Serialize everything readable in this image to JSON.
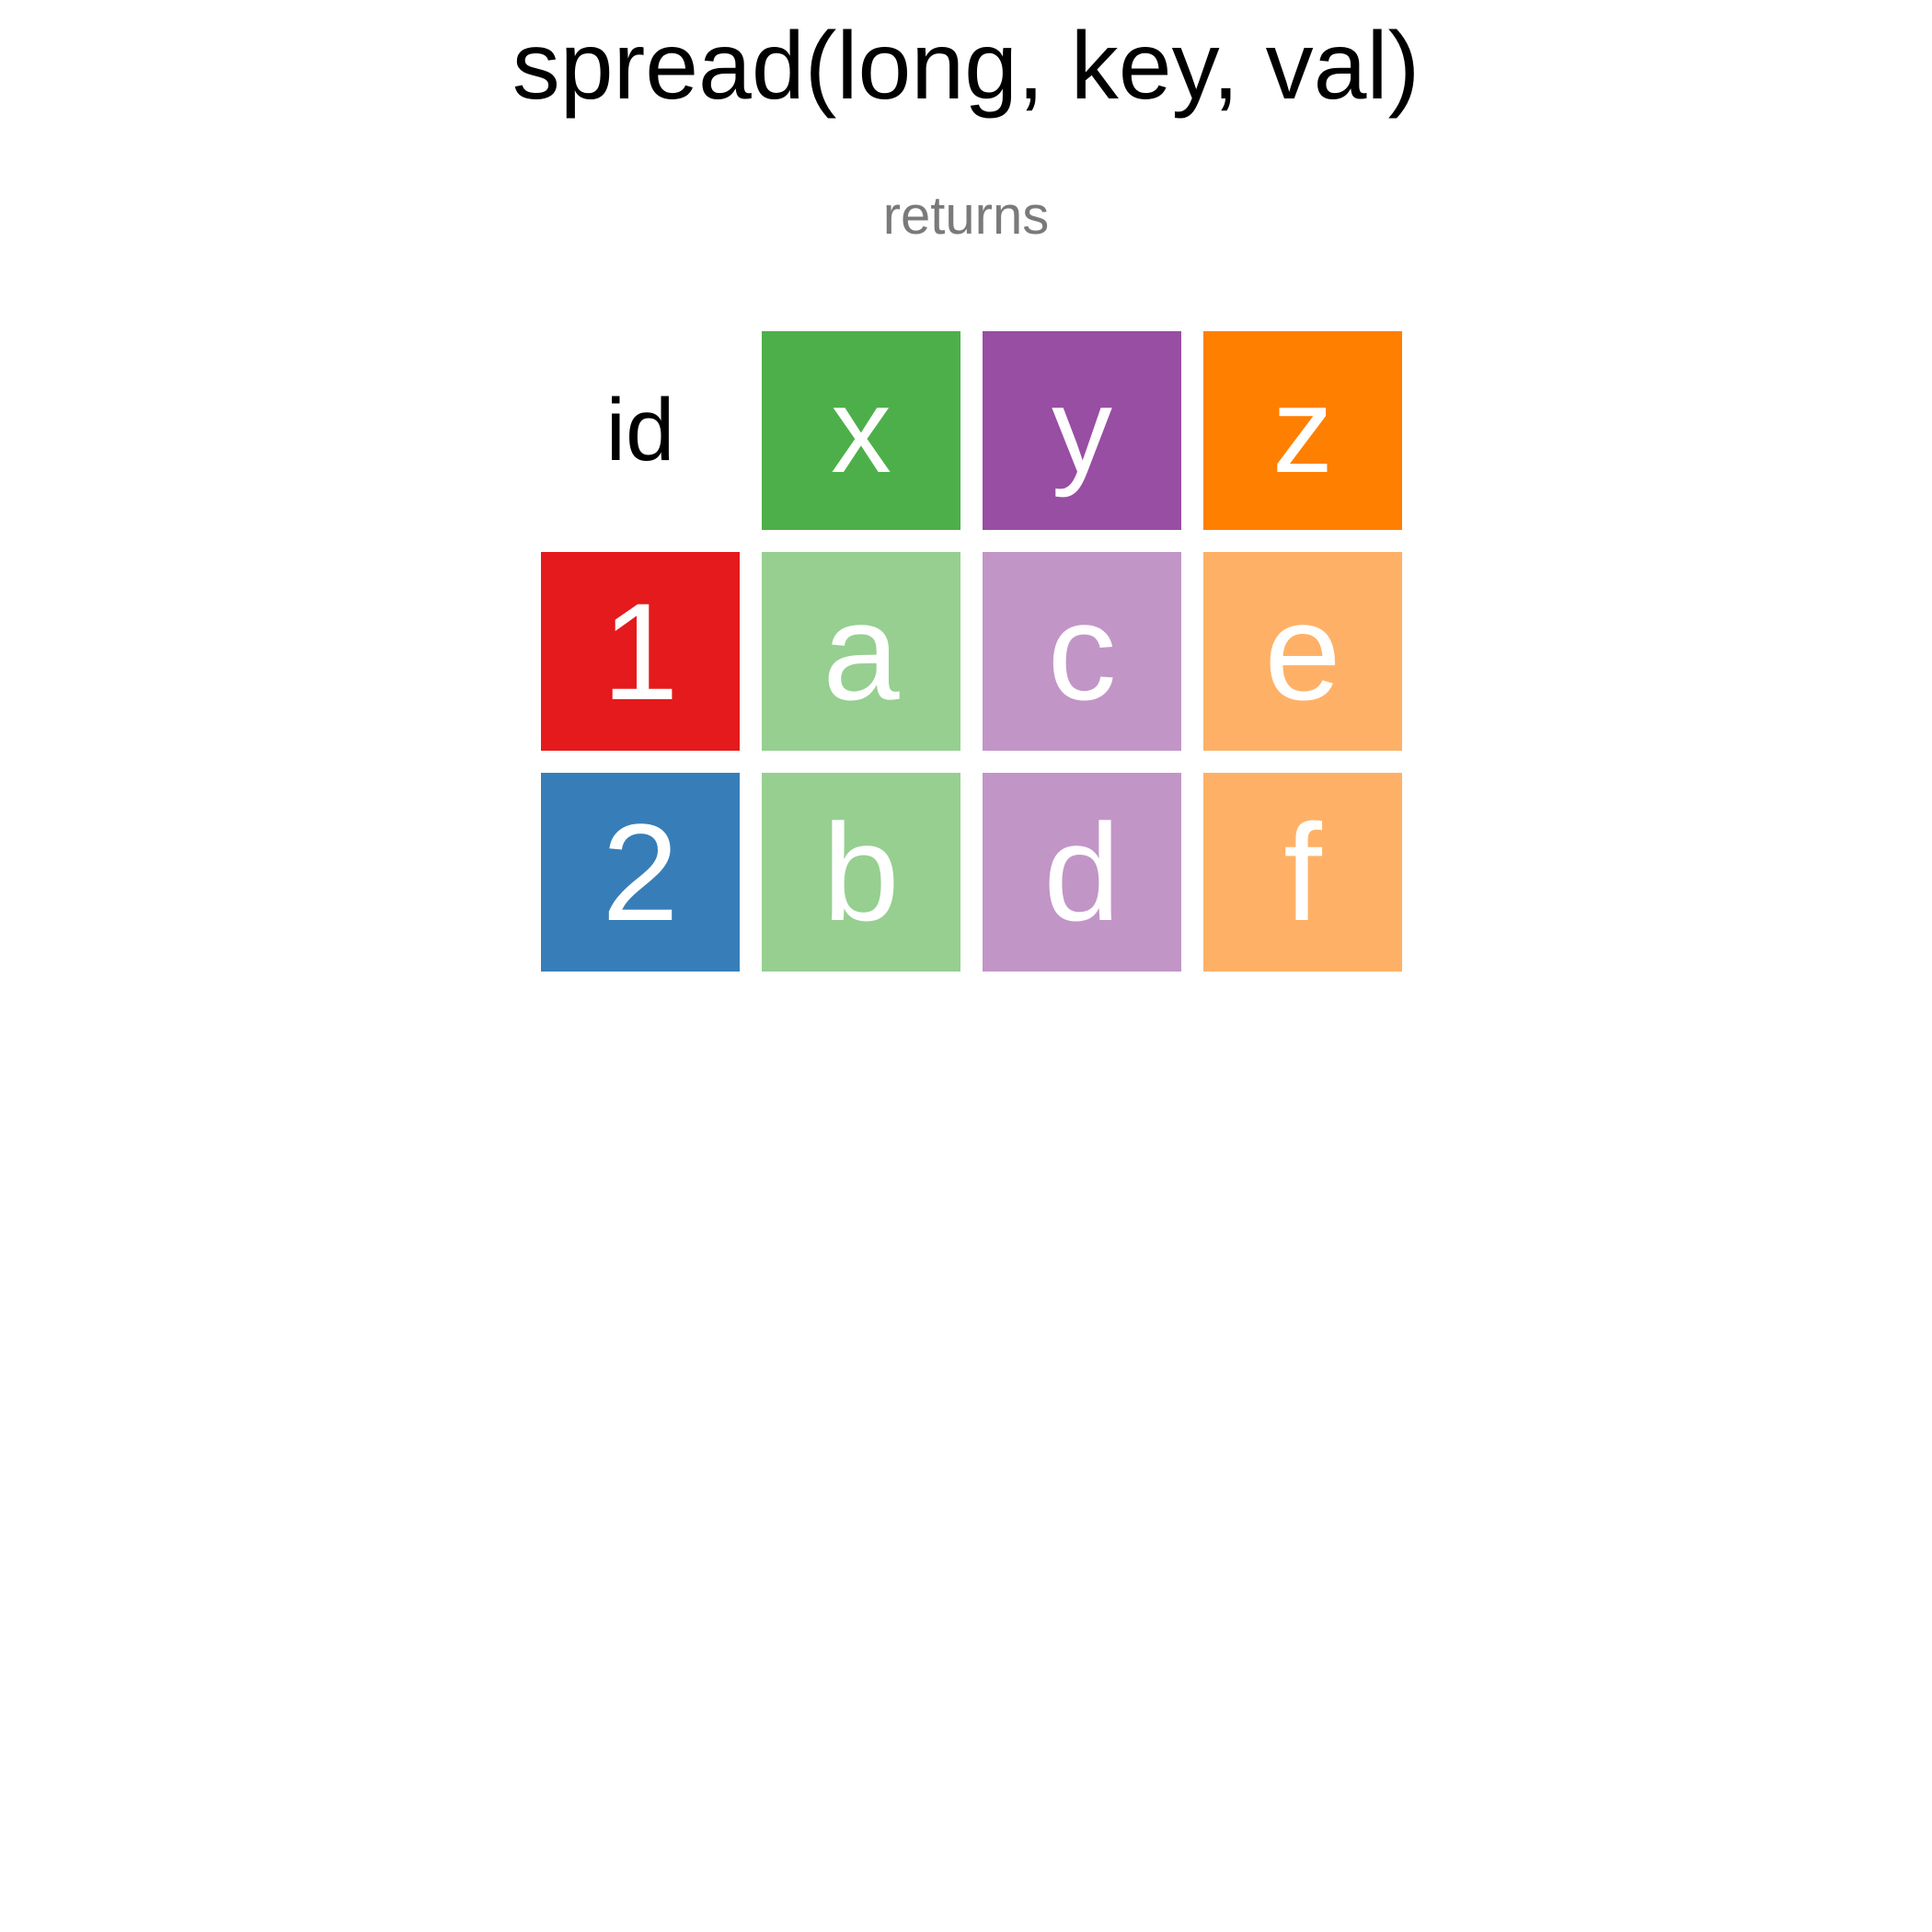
{
  "title": "spread(long, key, val)",
  "subtitle": "returns",
  "table": {
    "header": [
      {
        "label": "id",
        "color": "#ffffff"
      },
      {
        "label": "x",
        "color": "#4daf4a"
      },
      {
        "label": "y",
        "color": "#984ea3"
      },
      {
        "label": "z",
        "color": "#ff7f00"
      }
    ],
    "rows": [
      [
        {
          "label": "1",
          "color": "#e41a1c"
        },
        {
          "label": "a",
          "color": "#96cf90"
        },
        {
          "label": "c",
          "color": "#c295c7"
        },
        {
          "label": "e",
          "color": "#feb166"
        }
      ],
      [
        {
          "label": "2",
          "color": "#377eb8"
        },
        {
          "label": "b",
          "color": "#96cf90"
        },
        {
          "label": "d",
          "color": "#c295c7"
        },
        {
          "label": "f",
          "color": "#feb166"
        }
      ]
    ]
  }
}
